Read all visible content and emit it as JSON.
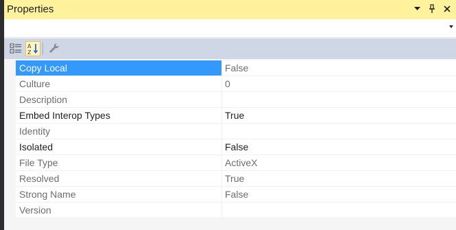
{
  "window": {
    "title": "Properties",
    "actions": [
      {
        "name": "dropdown-icon",
        "glyph": "▼"
      },
      {
        "name": "pin-icon",
        "glyph": "⊥"
      },
      {
        "name": "close-icon",
        "glyph": "✕"
      }
    ]
  },
  "toolbar": {
    "buttons": [
      {
        "name": "categorized-icon",
        "active": false
      },
      {
        "name": "alphabetical-icon",
        "active": true
      },
      {
        "name": "property-pages-icon",
        "active": false
      }
    ]
  },
  "grid": {
    "rows": [
      {
        "name": "Copy Local",
        "value": "False",
        "enabled": true,
        "selected": true
      },
      {
        "name": "Culture",
        "value": "0",
        "enabled": false
      },
      {
        "name": "Description",
        "value": "",
        "enabled": false
      },
      {
        "name": "Embed Interop Types",
        "value": "True",
        "enabled": true
      },
      {
        "name": "Identity",
        "value": "",
        "enabled": false
      },
      {
        "name": "Isolated",
        "value": "False",
        "enabled": true
      },
      {
        "name": "File Type",
        "value": "ActiveX",
        "enabled": false
      },
      {
        "name": "Resolved",
        "value": "True",
        "enabled": false
      },
      {
        "name": "Strong Name",
        "value": "False",
        "enabled": false
      },
      {
        "name": "Version",
        "value": "",
        "enabled": false
      }
    ]
  },
  "colors": {
    "title_bar": "#fff29d",
    "toolbar": "#cfd6e5",
    "selection": "#3399ff"
  }
}
